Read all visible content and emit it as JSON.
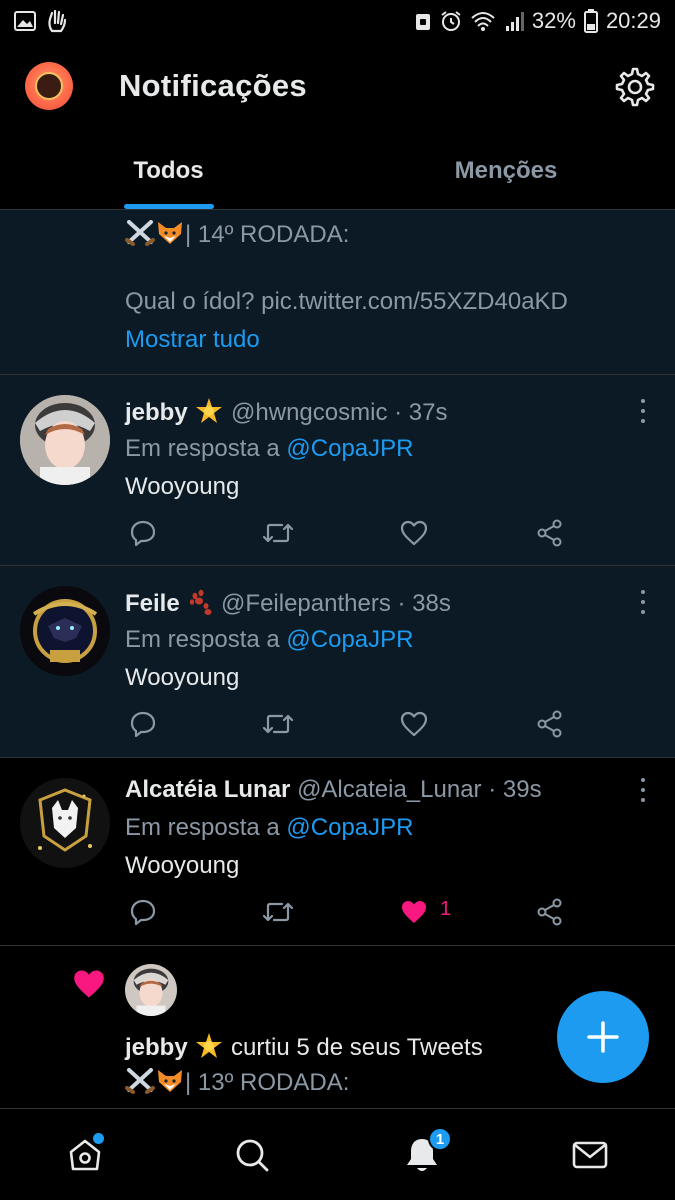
{
  "status_bar": {
    "battery": "32%",
    "time": "20:29"
  },
  "header": {
    "title": "Notificações"
  },
  "tabs": {
    "todos": "Todos",
    "mencoes": "Menções"
  },
  "top_item": {
    "line1": "| 14º RODADA:",
    "line2": "Qual o ídol? pic.twitter.com/55XZD40aKD",
    "show_all": "Mostrar tudo"
  },
  "replies": [
    {
      "name": "jebby",
      "handle": "@hwngcosmic",
      "time": "· 37s",
      "reply_prefix": "Em resposta a",
      "reply_to": "@CopaJPR",
      "text": "Wooyoung"
    },
    {
      "name": "Feile",
      "handle": "@Feilepanthers",
      "time": "· 38s",
      "reply_prefix": "Em resposta a",
      "reply_to": "@CopaJPR",
      "text": "Wooyoung"
    },
    {
      "name": "Alcatéia Lunar",
      "handle": "@Alcateia_Lunar",
      "time": "· 39s",
      "reply_prefix": "Em resposta a",
      "reply_to": "@CopaJPR",
      "text": "Wooyoung",
      "likes": "1"
    }
  ],
  "like_notification": {
    "name": "jebby",
    "action": "curtiu 5 de seus Tweets",
    "preview": "| 13º RODADA:"
  },
  "bottom_nav": {
    "notifications_badge": "1"
  },
  "colors": {
    "accent": "#1d9bf0",
    "like": "#f91880",
    "unread_bg": "#0b1a24"
  }
}
